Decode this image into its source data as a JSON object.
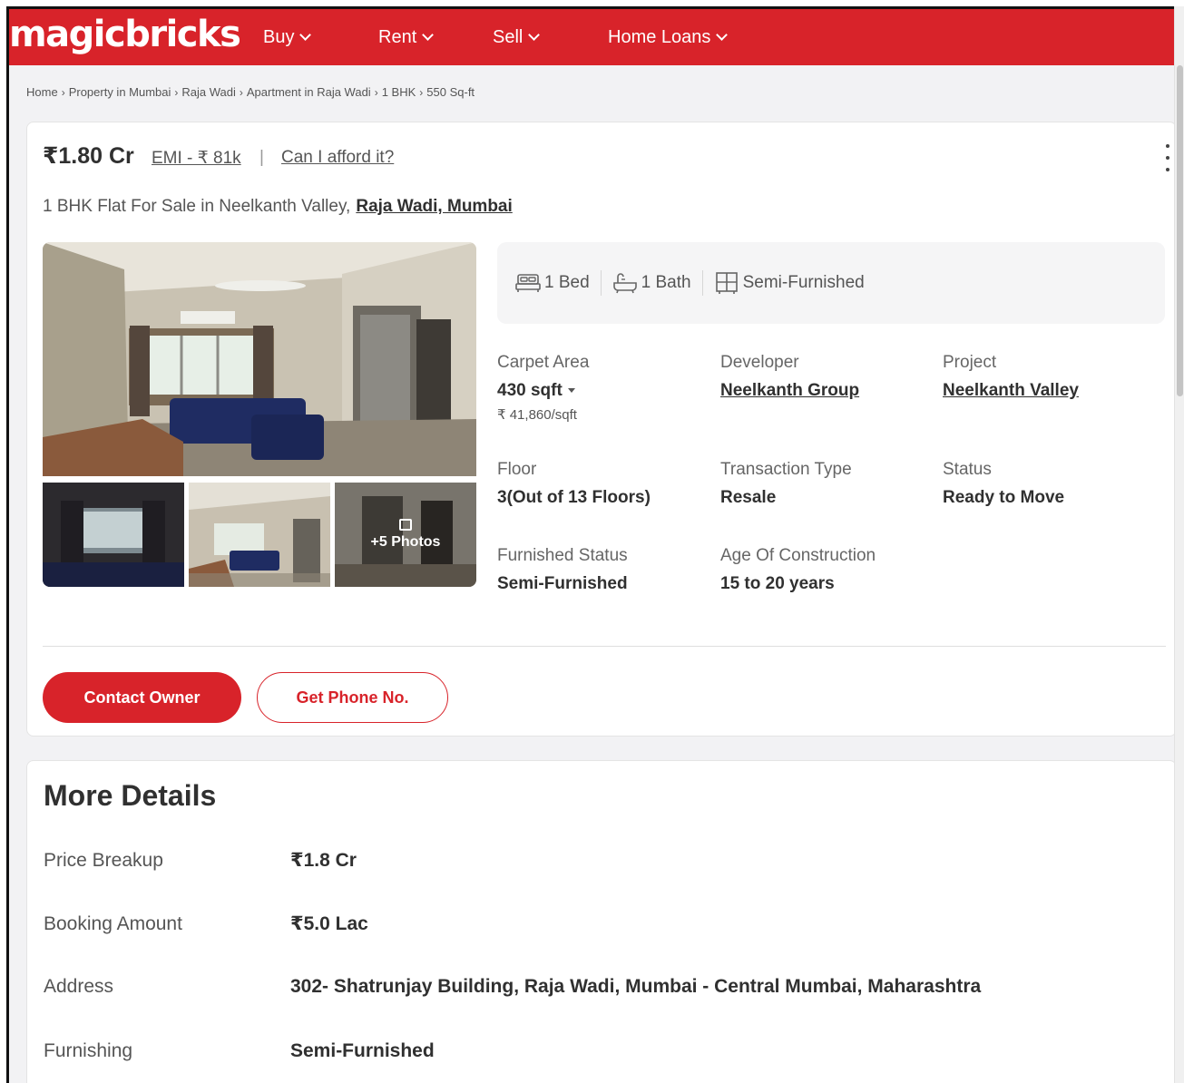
{
  "brand": {
    "logo_text": "magicbricks",
    "primary_color": "#d8232a"
  },
  "nav": {
    "items": [
      {
        "label": "Buy"
      },
      {
        "label": "Rent"
      },
      {
        "label": "Sell"
      },
      {
        "label": "Home Loans"
      }
    ]
  },
  "breadcrumb": [
    "Home",
    "Property in Mumbai",
    "Raja Wadi",
    "Apartment in Raja Wadi",
    "1 BHK",
    "550 Sq-ft"
  ],
  "listing": {
    "price": "₹1.80 Cr",
    "emi": "EMI - ₹ 81k",
    "separator": "|",
    "afford_link": "Can I afford it?",
    "title": "1 BHK Flat For Sale in Neelkanth Valley,",
    "location_link": "Raja Wadi, Mumbai",
    "more_photos": "+5 Photos",
    "amenities": {
      "bed": "1 Bed",
      "bath": "1 Bath",
      "furnishing": "Semi-Furnished"
    },
    "facts": {
      "carpet_area": {
        "label": "Carpet Area",
        "value": "430 sqft",
        "sub": "₹ 41,860/sqft"
      },
      "developer": {
        "label": "Developer",
        "value": "Neelkanth Group"
      },
      "project": {
        "label": "Project",
        "value": "Neelkanth Valley"
      },
      "floor": {
        "label": "Floor",
        "value": "3(Out of 13 Floors)"
      },
      "transaction": {
        "label": "Transaction Type",
        "value": "Resale"
      },
      "status": {
        "label": "Status",
        "value": "Ready to Move"
      },
      "furnished_status": {
        "label": "Furnished Status",
        "value": "Semi-Furnished"
      },
      "age": {
        "label": "Age Of Construction",
        "value": "15 to 20 years"
      }
    },
    "buttons": {
      "contact_owner": "Contact Owner",
      "get_phone": "Get Phone No."
    }
  },
  "more_details": {
    "title": "More Details",
    "rows": [
      {
        "label": "Price Breakup",
        "value": "₹1.8 Cr"
      },
      {
        "label": "Booking Amount",
        "value": "₹5.0 Lac"
      },
      {
        "label": "Address",
        "value": "302- Shatrunjay Building, Raja Wadi, Mumbai - Central Mumbai, Maharashtra"
      },
      {
        "label": "Furnishing",
        "value": "Semi-Furnished"
      }
    ]
  }
}
